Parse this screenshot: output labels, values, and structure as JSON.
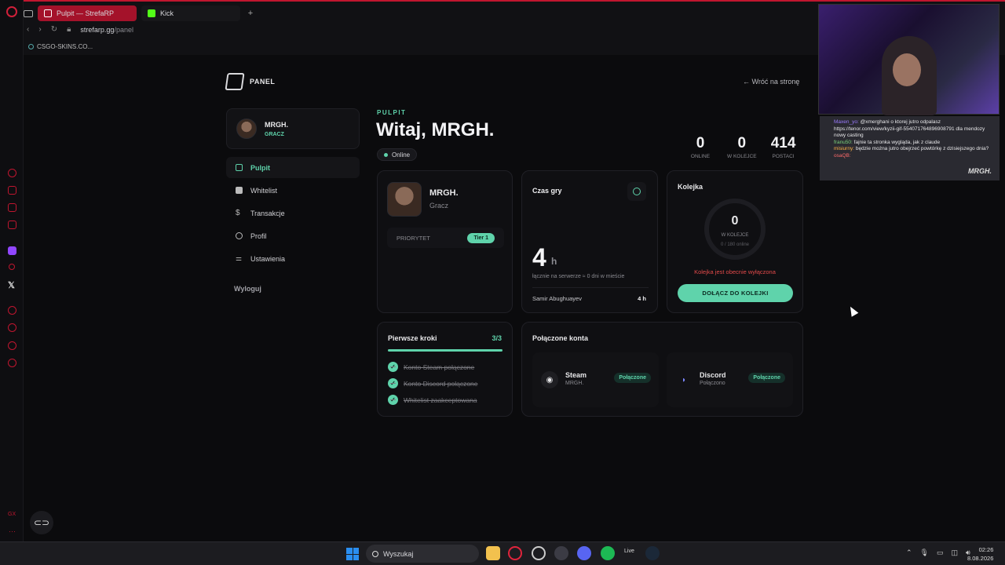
{
  "browser": {
    "tabs": [
      {
        "label": "Pulpit — StrefaRP",
        "active": true
      },
      {
        "label": "Kick",
        "active": false
      }
    ],
    "new_tab": "+",
    "url_host": "strefarp.gg",
    "url_path": "/panel",
    "bookmark": "CSGO-SKINS.CO..."
  },
  "sidebar_left": {
    "x_label": "𝕏",
    "gx_label": "GX",
    "more_label": "···"
  },
  "panel": {
    "brand_label": "PANEL",
    "back_link": "← Wróć na stronę",
    "user": {
      "name": "MRGH.",
      "role": "GRACZ"
    },
    "nav": [
      {
        "label": "Pulpit",
        "icon": "grid-icon",
        "active": true
      },
      {
        "label": "Whitelist",
        "icon": "checkbox-icon",
        "active": false
      },
      {
        "label": "Transakcje",
        "icon": "dollar-icon",
        "active": false
      },
      {
        "label": "Profil",
        "icon": "user-icon",
        "active": false
      },
      {
        "label": "Ustawienia",
        "icon": "sliders-icon",
        "active": false
      }
    ],
    "logout": "Wyloguj",
    "section_label": "PULPIT",
    "welcome": "Witaj, MRGH.",
    "status": "Online",
    "stats": [
      {
        "value": "0",
        "label": "ONLINE"
      },
      {
        "value": "0",
        "label": "W KOLEJCE"
      },
      {
        "value": "414",
        "label": "POSTACI"
      }
    ],
    "profile_card": {
      "name": "MRGH.",
      "role": "Gracz",
      "priority_label": "PRIORYTET",
      "tier": "Tier 1"
    },
    "playtime_card": {
      "title": "Czas gry",
      "value": "4",
      "unit": "h",
      "description": "łącznie na serwerze ≈ 0 dni w mieście",
      "character": "Samir Abughuayev",
      "character_hours": "4 h"
    },
    "queue_card": {
      "title": "Kolejka",
      "count": "0",
      "count_label": "W KOLEJCE",
      "online": "0 / 180 online",
      "warning": "Kolejka jest obecnie wyłączona",
      "button": "DOŁĄCZ DO KOLEJKI"
    },
    "steps_card": {
      "title": "Pierwsze kroki",
      "progress": "3/3",
      "progress_fraction": 1.0,
      "steps": [
        "Konto Steam połączone",
        "Konto Discord połączone",
        "Whitelist zaakceptowana"
      ]
    },
    "accounts_card": {
      "title": "Połączone konta",
      "accounts": [
        {
          "name": "Steam",
          "sub": "MRGH.",
          "badge": "Połączone",
          "icon": "steam-icon"
        },
        {
          "name": "Discord",
          "sub": "Połączono",
          "badge": "Połączone",
          "icon": "discord-icon"
        }
      ]
    }
  },
  "stream_chat": {
    "lines": [
      {
        "user": "Maxen_yo:",
        "text": "@xmerghani o ktorej jutro odpalasz"
      },
      {
        "user": "",
        "text": "https://tenor.com/view/kyzii-gif-554071764896908791 dla mendozy nowy casting"
      },
      {
        "user": "franu50:",
        "text": "fajnie ta stronka wygląda, jak z claude"
      },
      {
        "user": "misiurny:",
        "text": "będzie można jutro obejrzeć powtórkę z dzisiejszego dnia?"
      },
      {
        "user": "osaQB:",
        "text": ""
      }
    ],
    "signature": "MRGH."
  },
  "taskbar": {
    "search_placeholder": "Wyszukaj",
    "live_label": "Live",
    "time": "02:26",
    "date": "8.08.2026"
  }
}
